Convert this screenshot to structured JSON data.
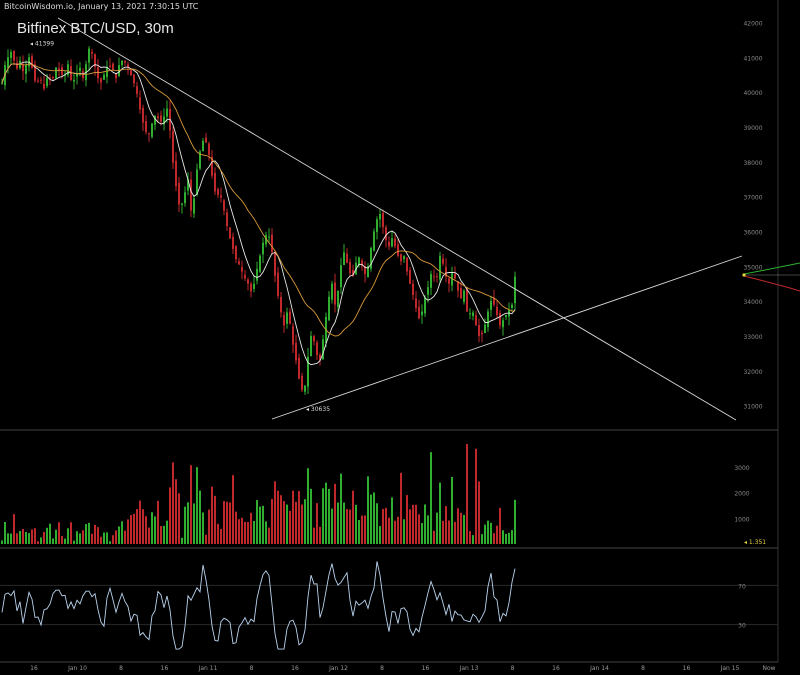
{
  "header": {
    "site": "BitcoinWisdom.io",
    "timestamp": "January 13, 2021 7:30:15 UTC"
  },
  "chart_data": [
    {
      "type": "candlestick",
      "title": "Bitfinex BTC/USD, 30m",
      "ylim": [
        30300,
        42300
      ],
      "yticks": [
        31000,
        32000,
        33000,
        34000,
        35000,
        36000,
        37000,
        38000,
        39000,
        40000,
        41000,
        42000
      ],
      "xticks": [
        "16",
        "Jan 10",
        "8",
        "16",
        "Jan 11",
        "8",
        "16",
        "Jan 12",
        "8",
        "16",
        "Jan 13",
        "8",
        "16",
        "Jan 14",
        "8",
        "16",
        "Jan 15",
        "Now"
      ],
      "annotations": {
        "high_label": "41399",
        "low_label": "30635"
      },
      "close_path": [
        [
          0,
          39800
        ],
        [
          4,
          40700
        ],
        [
          8,
          41000
        ],
        [
          12,
          41200
        ],
        [
          16,
          40600
        ],
        [
          20,
          40900
        ],
        [
          24,
          40500
        ],
        [
          28,
          41100
        ],
        [
          32,
          40700
        ],
        [
          36,
          40200
        ],
        [
          40,
          40400
        ],
        [
          44,
          40100
        ],
        [
          48,
          40500
        ],
        [
          52,
          40300
        ],
        [
          56,
          40700
        ],
        [
          60,
          40600
        ],
        [
          64,
          40400
        ],
        [
          68,
          40800
        ],
        [
          72,
          40200
        ],
        [
          76,
          40500
        ],
        [
          80,
          40700
        ],
        [
          84,
          40300
        ],
        [
          88,
          41300
        ],
        [
          92,
          41100
        ],
        [
          96,
          40600
        ],
        [
          100,
          40200
        ],
        [
          104,
          40500
        ],
        [
          108,
          40800
        ],
        [
          112,
          40700
        ],
        [
          116,
          40400
        ],
        [
          120,
          40900
        ],
        [
          124,
          40900
        ],
        [
          128,
          40700
        ],
        [
          132,
          40400
        ],
        [
          136,
          40100
        ],
        [
          140,
          39500
        ],
        [
          144,
          39000
        ],
        [
          148,
          38700
        ],
        [
          152,
          39100
        ],
        [
          156,
          39400
        ],
        [
          160,
          39100
        ],
        [
          164,
          39300
        ],
        [
          168,
          39600
        ],
        [
          172,
          38200
        ],
        [
          176,
          37300
        ],
        [
          180,
          36600
        ],
        [
          184,
          37000
        ],
        [
          188,
          37500
        ],
        [
          192,
          36300
        ],
        [
          196,
          37600
        ],
        [
          200,
          38300
        ],
        [
          204,
          38700
        ],
        [
          208,
          38400
        ],
        [
          212,
          37600
        ],
        [
          216,
          37000
        ],
        [
          220,
          37100
        ],
        [
          224,
          36600
        ],
        [
          228,
          36000
        ],
        [
          232,
          35600
        ],
        [
          236,
          35200
        ],
        [
          240,
          35000
        ],
        [
          244,
          34700
        ],
        [
          248,
          34500
        ],
        [
          252,
          34200
        ],
        [
          256,
          34800
        ],
        [
          260,
          35300
        ],
        [
          264,
          35800
        ],
        [
          268,
          36000
        ],
        [
          272,
          35400
        ],
        [
          276,
          34500
        ],
        [
          280,
          33800
        ],
        [
          284,
          33300
        ],
        [
          288,
          33800
        ],
        [
          292,
          32900
        ],
        [
          296,
          32300
        ],
        [
          300,
          31600
        ],
        [
          304,
          31300
        ],
        [
          308,
          32400
        ],
        [
          312,
          33200
        ],
        [
          316,
          32500
        ],
        [
          320,
          32300
        ],
        [
          324,
          33100
        ],
        [
          328,
          34000
        ],
        [
          332,
          34500
        ],
        [
          336,
          33700
        ],
        [
          340,
          34900
        ],
        [
          344,
          35400
        ],
        [
          348,
          35000
        ],
        [
          352,
          34600
        ],
        [
          356,
          35100
        ],
        [
          360,
          35300
        ],
        [
          364,
          34700
        ],
        [
          368,
          35000
        ],
        [
          372,
          35700
        ],
        [
          376,
          36300
        ],
        [
          380,
          36500
        ],
        [
          384,
          36000
        ],
        [
          388,
          35500
        ],
        [
          392,
          35800
        ],
        [
          396,
          35500
        ],
        [
          400,
          35100
        ],
        [
          404,
          35300
        ],
        [
          408,
          34700
        ],
        [
          412,
          34300
        ],
        [
          416,
          33800
        ],
        [
          420,
          33400
        ],
        [
          424,
          34000
        ],
        [
          428,
          34400
        ],
        [
          432,
          34900
        ],
        [
          436,
          34500
        ],
        [
          440,
          35300
        ],
        [
          444,
          35000
        ],
        [
          448,
          34400
        ],
        [
          452,
          34800
        ],
        [
          456,
          34600
        ],
        [
          460,
          34000
        ],
        [
          464,
          34300
        ],
        [
          468,
          33500
        ],
        [
          472,
          33800
        ],
        [
          476,
          33300
        ],
        [
          480,
          32900
        ],
        [
          484,
          33200
        ],
        [
          488,
          33700
        ],
        [
          492,
          34100
        ],
        [
          496,
          33700
        ],
        [
          500,
          33300
        ],
        [
          504,
          33500
        ],
        [
          508,
          33700
        ],
        [
          512,
          33900
        ],
        [
          514,
          34700
        ]
      ],
      "volume_yticks": [
        1000,
        2000,
        3000
      ],
      "volume_marker": "1.351",
      "indicator_yticks": [
        30,
        70
      ]
    }
  ]
}
